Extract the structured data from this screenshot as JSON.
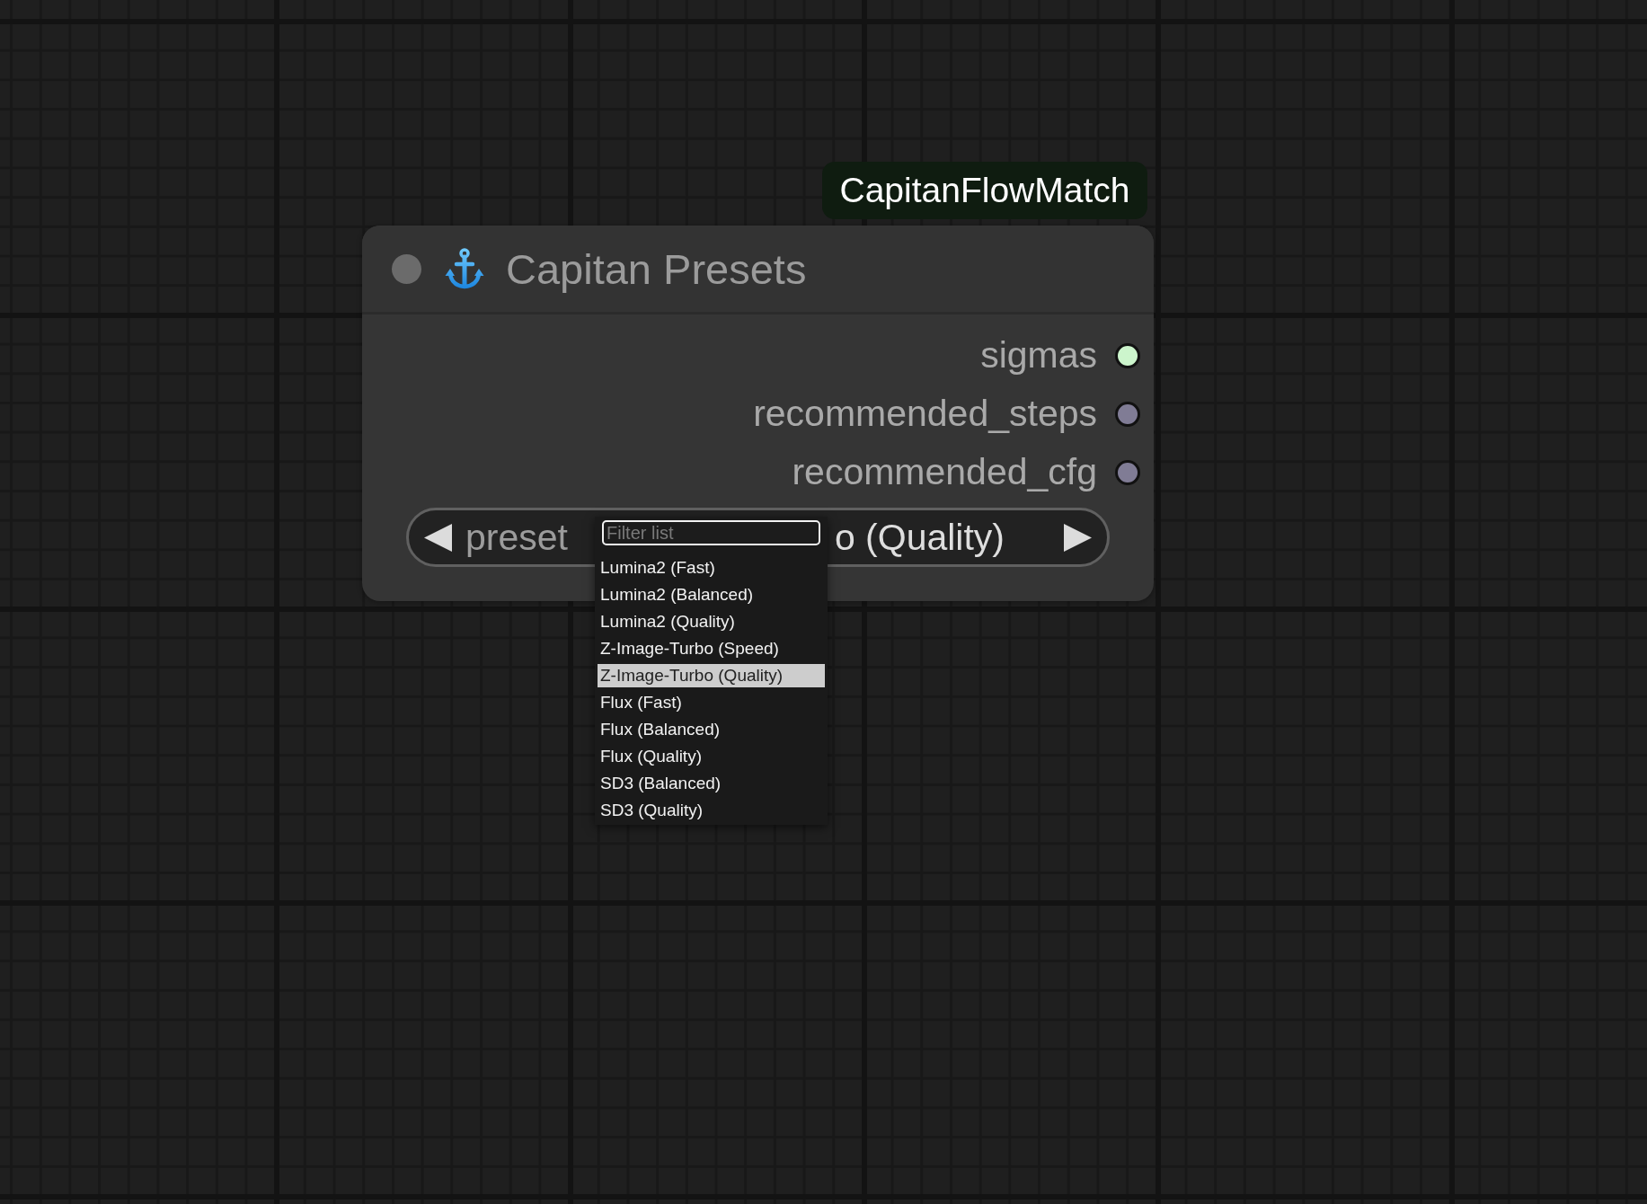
{
  "node": {
    "badge": "CapitanFlowMatch",
    "title": "Capitan Presets",
    "outputs": [
      {
        "name": "sigmas",
        "color": "#ccf5cc"
      },
      {
        "name": "recommended_steps",
        "color": "#807c95"
      },
      {
        "name": "recommended_cfg",
        "color": "#807c95"
      }
    ],
    "widgets": [
      {
        "kind": "combo",
        "label": "preset",
        "value": "o (Quality)"
      }
    ]
  },
  "dropdown": {
    "filter": {
      "placeholder": "Filter list"
    },
    "items": [
      {
        "label": "Lumina2 (Fast)",
        "selected": false
      },
      {
        "label": "Lumina2 (Balanced)",
        "selected": false
      },
      {
        "label": "Lumina2 (Quality)",
        "selected": false
      },
      {
        "label": "Z-Image-Turbo (Speed)",
        "selected": false
      },
      {
        "label": "Z-Image-Turbo (Quality)",
        "selected": true
      },
      {
        "label": "Flux (Fast)",
        "selected": false
      },
      {
        "label": "Flux (Balanced)",
        "selected": false
      },
      {
        "label": "Flux (Quality)",
        "selected": false
      },
      {
        "label": "SD3 (Balanced)",
        "selected": false
      },
      {
        "label": "SD3 (Quality)",
        "selected": false
      }
    ]
  }
}
